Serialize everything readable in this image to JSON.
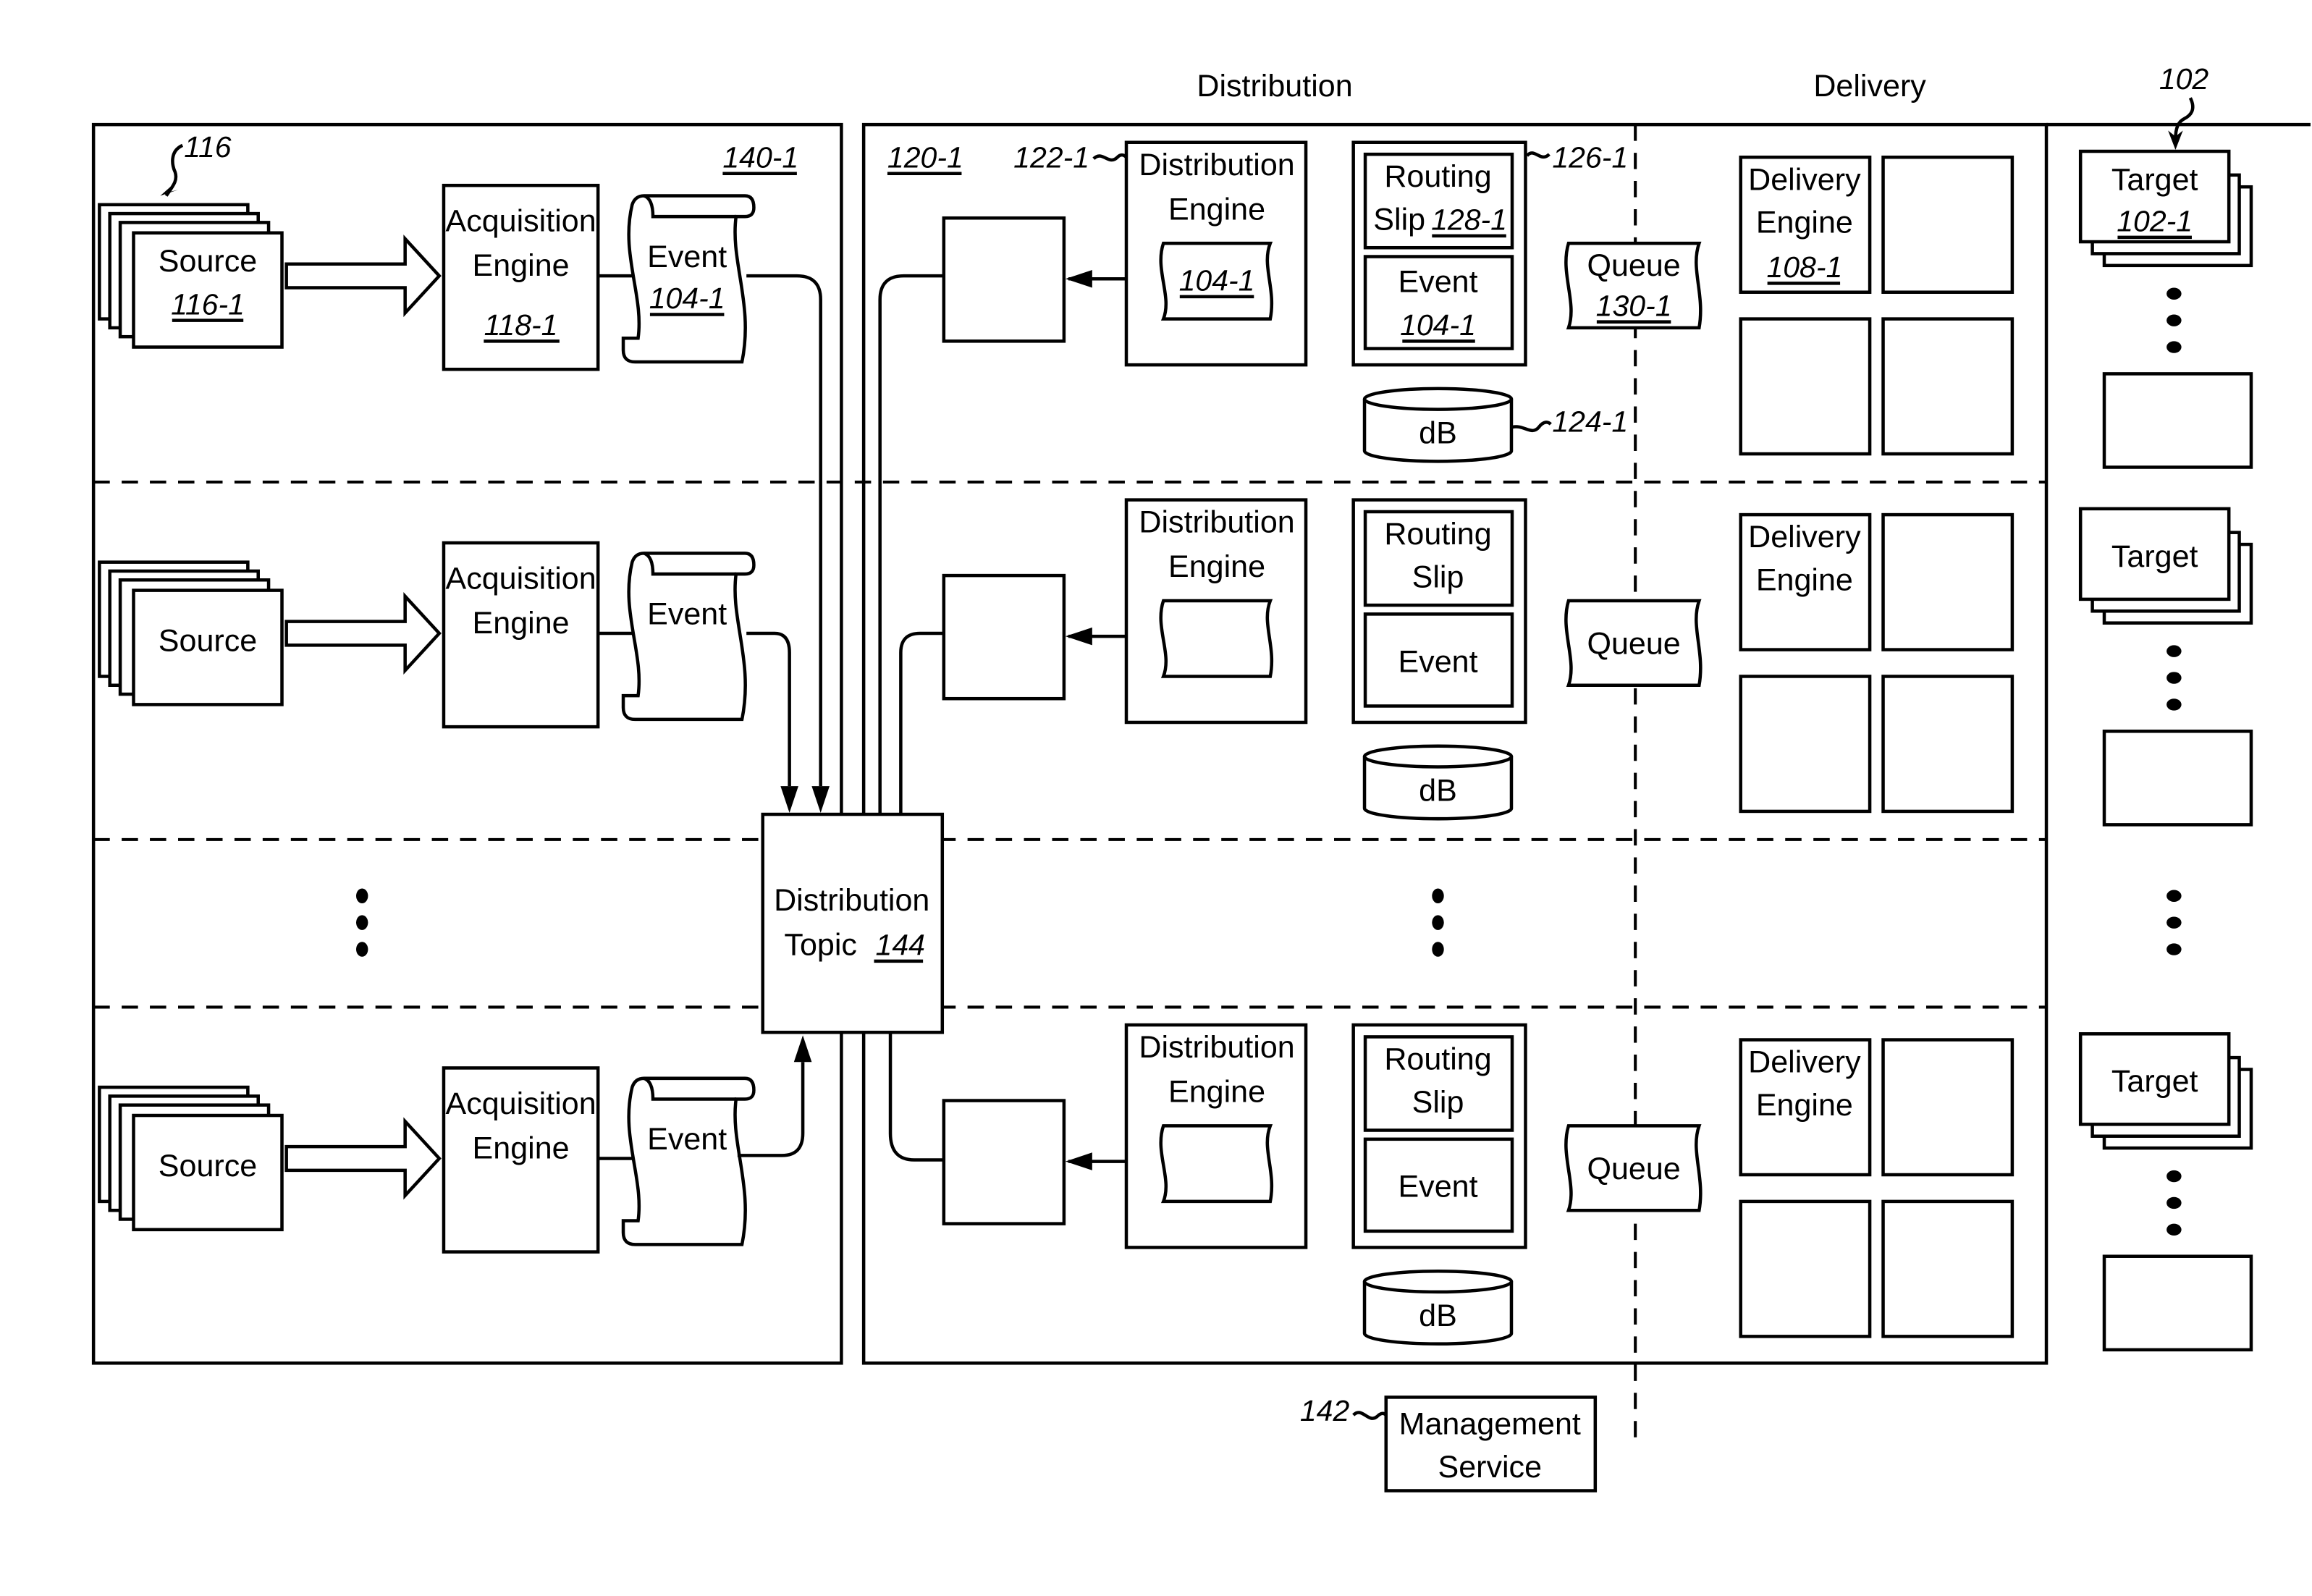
{
  "headers": {
    "distribution": "Distribution",
    "delivery": "Delivery"
  },
  "refs": {
    "sources_group": "116",
    "targets_group": "102",
    "acq_panel": "140-1",
    "dist_panel": "120-1",
    "dist_engine": "122-1",
    "routing_container": "126-1",
    "db": "124-1",
    "mgmt": "142"
  },
  "rows": [
    {
      "source": "Source",
      "source_ref": "116-1",
      "acq_line1": "Acquisition",
      "acq_line2": "Engine",
      "acq_ref": "118-1",
      "event": "Event",
      "event_ref": "104-1",
      "de_line1": "Distribution",
      "de_line2": "Engine",
      "de_event_ref": "104-1",
      "rs_line1": "Routing",
      "rs_line2": "Slip",
      "rs_ref": "128-1",
      "rs_event": "Event",
      "rs_event_ref": "104-1",
      "db": "dB",
      "queue": "Queue",
      "queue_ref": "130-1",
      "deliv_line1": "Delivery",
      "deliv_line2": "Engine",
      "deliv_ref": "108-1",
      "target": "Target",
      "target_ref": "102-1"
    },
    {
      "source": "Source",
      "acq_line1": "Acquisition",
      "acq_line2": "Engine",
      "event": "Event",
      "de_line1": "Distribution",
      "de_line2": "Engine",
      "rs_line1": "Routing",
      "rs_line2": "Slip",
      "rs_event": "Event",
      "db": "dB",
      "queue": "Queue",
      "deliv_line1": "Delivery",
      "deliv_line2": "Engine",
      "target": "Target"
    },
    {
      "source": "Source",
      "acq_line1": "Acquisition",
      "acq_line2": "Engine",
      "event": "Event",
      "de_line1": "Distribution",
      "de_line2": "Engine",
      "rs_line1": "Routing",
      "rs_line2": "Slip",
      "rs_event": "Event",
      "db": "dB",
      "queue": "Queue",
      "deliv_line1": "Delivery",
      "deliv_line2": "Engine",
      "target": "Target"
    }
  ],
  "topic": {
    "line1": "Distribution",
    "line2": "Topic",
    "ref": "144"
  },
  "management": {
    "line1": "Management",
    "line2": "Service"
  }
}
